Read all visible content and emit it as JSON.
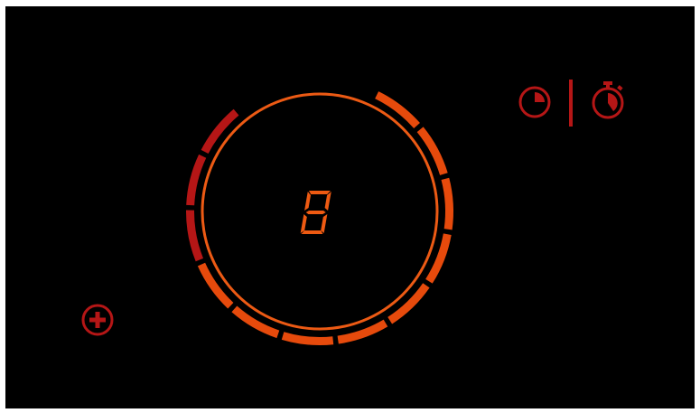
{
  "cooktop": {
    "display_digit": "8",
    "power_level": {
      "active_segments": 9,
      "total_segments": 12
    },
    "colors": {
      "background": "#000000",
      "accent_active": "#e64a0c",
      "accent_inactive": "#b51616",
      "ring": "#ec5a14",
      "digit": "#ee5a12"
    }
  },
  "controls": {
    "boost_icon": "plus-circle-icon",
    "timer_icon": "clock-timer-icon",
    "stopwatch_icon": "stopwatch-icon"
  }
}
